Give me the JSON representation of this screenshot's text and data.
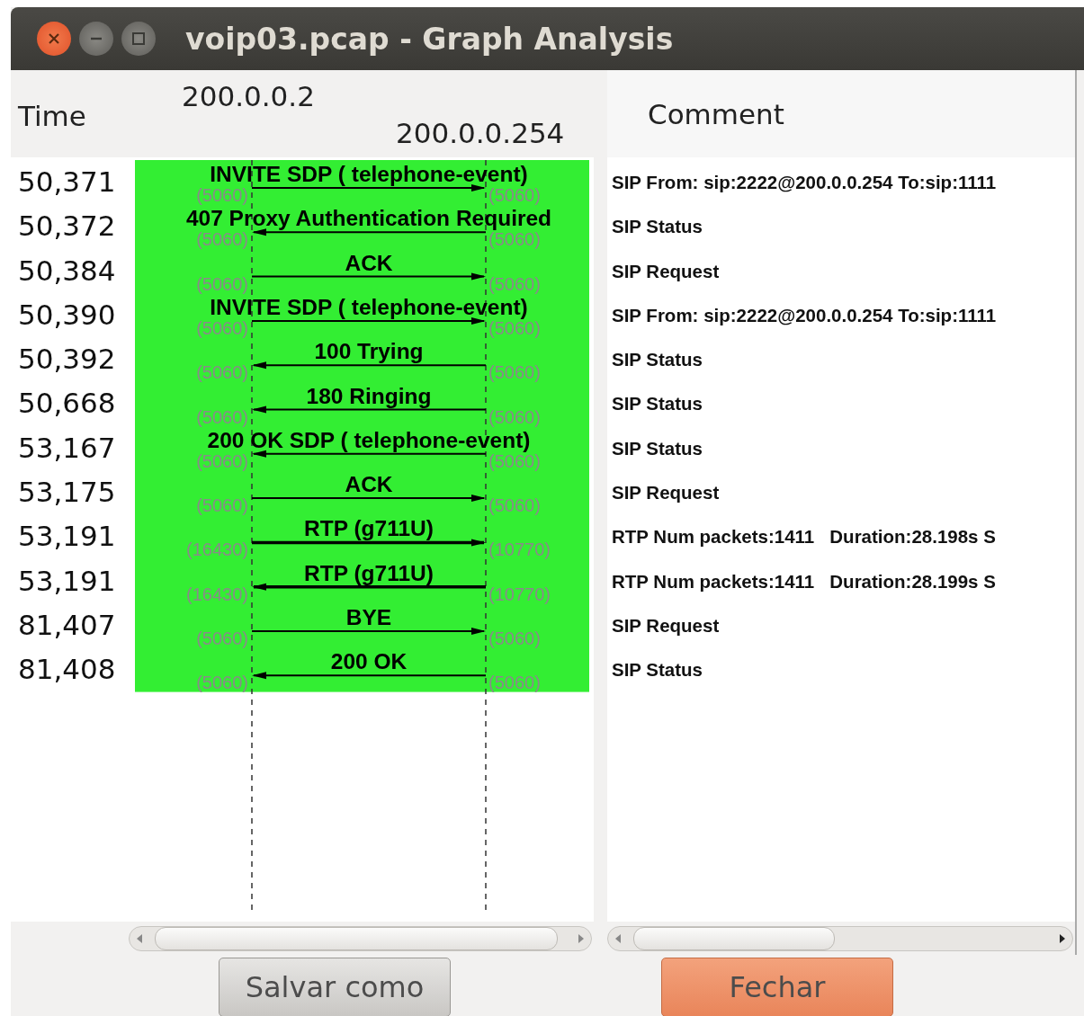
{
  "window": {
    "title": "voip03.pcap - Graph Analysis"
  },
  "header": {
    "time": "Time",
    "host_a": "200.0.0.2",
    "host_b": "200.0.0.254",
    "comment": "Comment"
  },
  "rows": [
    {
      "time": "50,371",
      "label": "INVITE SDP ( telephone-event)",
      "to_right": true,
      "kind": "sip",
      "port_a": "(5060)",
      "port_b": "(5060)",
      "comment": "SIP From: sip:2222@200.0.0.254 To:sip:1111"
    },
    {
      "time": "50,372",
      "label": "407 Proxy Authentication Required",
      "to_right": false,
      "kind": "sip",
      "port_a": "(5060)",
      "port_b": "(5060)",
      "comment": "SIP Status"
    },
    {
      "time": "50,384",
      "label": "ACK",
      "to_right": true,
      "kind": "sip",
      "port_a": "(5060)",
      "port_b": "(5060)",
      "comment": "SIP Request"
    },
    {
      "time": "50,390",
      "label": "INVITE SDP ( telephone-event)",
      "to_right": true,
      "kind": "sip",
      "port_a": "(5060)",
      "port_b": "(5060)",
      "comment": "SIP From: sip:2222@200.0.0.254 To:sip:1111"
    },
    {
      "time": "50,392",
      "label": "100 Trying",
      "to_right": false,
      "kind": "sip",
      "port_a": "(5060)",
      "port_b": "(5060)",
      "comment": "SIP Status"
    },
    {
      "time": "50,668",
      "label": "180 Ringing",
      "to_right": false,
      "kind": "sip",
      "port_a": "(5060)",
      "port_b": "(5060)",
      "comment": "SIP Status"
    },
    {
      "time": "53,167",
      "label": "200 OK SDP ( telephone-event)",
      "to_right": false,
      "kind": "sip",
      "port_a": "(5060)",
      "port_b": "(5060)",
      "comment": "SIP Status"
    },
    {
      "time": "53,175",
      "label": "ACK",
      "to_right": true,
      "kind": "sip",
      "port_a": "(5060)",
      "port_b": "(5060)",
      "comment": "SIP Request"
    },
    {
      "time": "53,191",
      "label": "RTP (g711U)",
      "to_right": true,
      "kind": "rtp",
      "port_a": "(16430)",
      "port_b": "(10770)",
      "comment": "RTP Num packets:1411   Duration:28.198s S"
    },
    {
      "time": "53,191",
      "label": "RTP (g711U)",
      "to_right": false,
      "kind": "rtp",
      "port_a": "(16430)",
      "port_b": "(10770)",
      "comment": "RTP Num packets:1411   Duration:28.199s S"
    },
    {
      "time": "81,407",
      "label": "BYE",
      "to_right": true,
      "kind": "sip",
      "port_a": "(5060)",
      "port_b": "(5060)",
      "comment": "SIP Request"
    },
    {
      "time": "81,408",
      "label": "200 OK",
      "to_right": false,
      "kind": "sip",
      "port_a": "(5060)",
      "port_b": "(5060)",
      "comment": "SIP Status"
    }
  ],
  "buttons": [
    {
      "label": "Salvar como",
      "primary": false
    },
    {
      "label": "Fechar",
      "primary": true
    }
  ]
}
